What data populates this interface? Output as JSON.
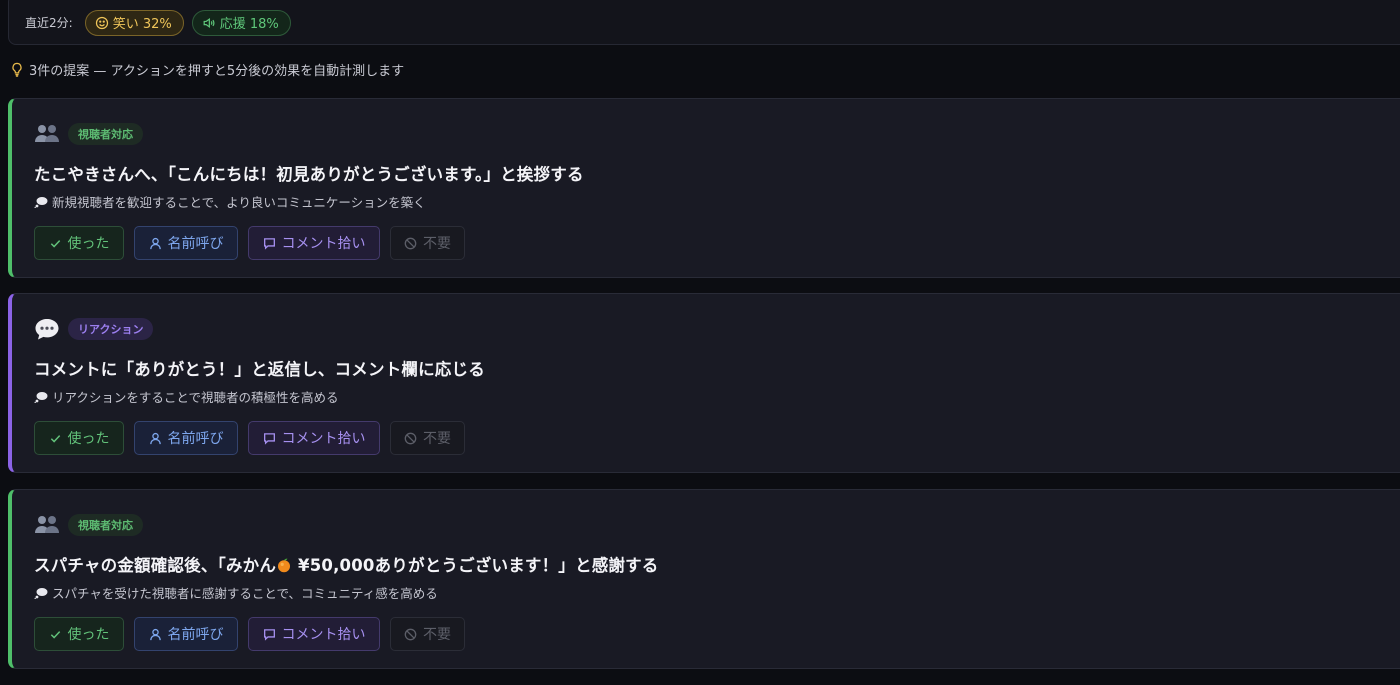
{
  "stats": {
    "label": "直近2分:",
    "chips": [
      {
        "label": "笑い 32%",
        "icon": "smile-icon",
        "color": "#f0c65a"
      },
      {
        "label": "応援 18%",
        "icon": "megaphone-icon",
        "color": "#5fc77a"
      }
    ]
  },
  "hint": {
    "icon": "lightbulb-icon",
    "text": "3件の提案 — アクションを押すと5分後の効果を自動計測します"
  },
  "actions": {
    "used": "使った",
    "name_call": "名前呼び",
    "comment_pick": "コメント拾い",
    "unneeded": "不要"
  },
  "suggestions": [
    {
      "icon": "people-icon",
      "tag": "視聴者対応",
      "accent": "#4fbf6a",
      "title": "たこやきさんへ、「こんにちは！初見ありがとうございます。」と挨拶する",
      "reason": "新規視聴者を歓迎することで、より良いコミュニケーションを築く"
    },
    {
      "icon": "speech-bubble-icon",
      "tag": "リアクション",
      "accent": "#8b63e6",
      "title": "コメントに「ありがとう！」と返信し、コメント欄に応じる",
      "reason": "リアクションをすることで視聴者の積極性を高める"
    },
    {
      "icon": "people-icon",
      "tag": "視聴者対応",
      "accent": "#4fbf6a",
      "title_before": "スパチャの金額確認後、「みかん",
      "title_emoji": "tangerine-emoji",
      "title_after": " ¥50,000ありがとうございます！」と感謝する",
      "reason": "スパチャを受けた視聴者に感謝することで、コミュニティ感を高める"
    }
  ]
}
